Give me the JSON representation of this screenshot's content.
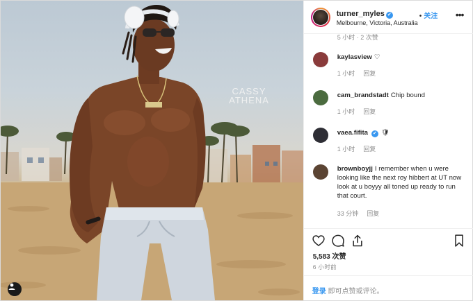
{
  "post": {
    "username": "turner_myles",
    "verified_mark": "✔",
    "follow_label": "关注",
    "location": "Melbourne, Victoria, Australia",
    "more_label": "•••",
    "watermark_line1": "CASSY",
    "watermark_line2": "ATHENA"
  },
  "comments_header_cut": "5 小时 · 2 次赞",
  "comments": [
    {
      "username": "kaylasview",
      "text": "♡",
      "time": "1 小时",
      "reply": "回复",
      "avatar_color": "#8a3b3b"
    },
    {
      "username": "cam_brandstadt",
      "text": "Chip bound",
      "time": "1 小时",
      "reply": "回复",
      "avatar_color": "#4b6b3f"
    },
    {
      "username": "vaea.fifita",
      "text": "🛡",
      "time": "1 小时",
      "reply": "回复",
      "avatar_color": "#2e2e35",
      "verified": true
    },
    {
      "username": "brownboyjj",
      "text": "I remember when u were looking like the next roy hibbert at UT now look at u boyyy all toned up ready to run that court.",
      "time": "33 分钟",
      "reply": "回复",
      "avatar_color": "#5b4433"
    }
  ],
  "actions": {
    "like_icon": "heart-icon",
    "comment_icon": "comment-icon",
    "share_icon": "share-icon",
    "save_icon": "bookmark-icon"
  },
  "likes_text": "5,583 次赞",
  "posted_time": "6 小时前",
  "login": {
    "link": "登录",
    "suffix": " 即可点赞或评论。"
  },
  "colors": {
    "accent": "#3897f0",
    "muted": "#8e8e8e",
    "text": "#262626",
    "border": "#efefef"
  }
}
